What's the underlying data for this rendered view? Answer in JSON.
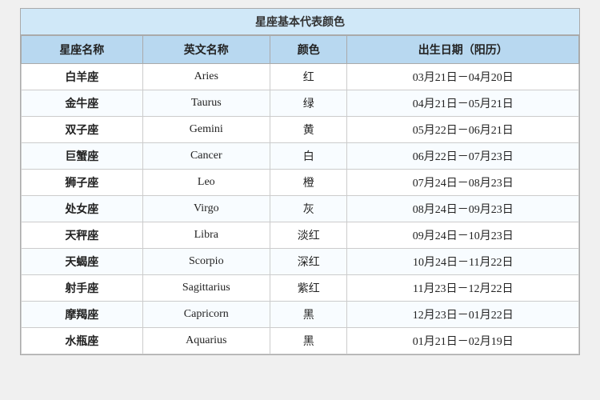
{
  "title": "星座基本代表颜色",
  "headers": [
    "星座名称",
    "英文名称",
    "颜色",
    "出生日期（阳历）"
  ],
  "rows": [
    {
      "chinese": "白羊座",
      "english": "Aries",
      "color": "红",
      "dates": "03月21日－04月20日"
    },
    {
      "chinese": "金牛座",
      "english": "Taurus",
      "color": "绿",
      "dates": "04月21日－05月21日"
    },
    {
      "chinese": "双子座",
      "english": "Gemini",
      "color": "黄",
      "dates": "05月22日－06月21日"
    },
    {
      "chinese": "巨蟹座",
      "english": "Cancer",
      "color": "白",
      "dates": "06月22日－07月23日"
    },
    {
      "chinese": "狮子座",
      "english": "Leo",
      "color": "橙",
      "dates": "07月24日－08月23日"
    },
    {
      "chinese": "处女座",
      "english": "Virgo",
      "color": "灰",
      "dates": "08月24日－09月23日"
    },
    {
      "chinese": "天秤座",
      "english": "Libra",
      "color": "淡红",
      "dates": "09月24日－10月23日"
    },
    {
      "chinese": "天蝎座",
      "english": "Scorpio",
      "color": "深红",
      "dates": "10月24日－11月22日"
    },
    {
      "chinese": "射手座",
      "english": "Sagittarius",
      "color": "紫红",
      "dates": "11月23日－12月22日"
    },
    {
      "chinese": "摩羯座",
      "english": "Capricorn",
      "color": "黑",
      "dates": "12月23日－01月22日"
    },
    {
      "chinese": "水瓶座",
      "english": "Aquarius",
      "color": "黑",
      "dates": "01月21日－02月19日"
    }
  ]
}
